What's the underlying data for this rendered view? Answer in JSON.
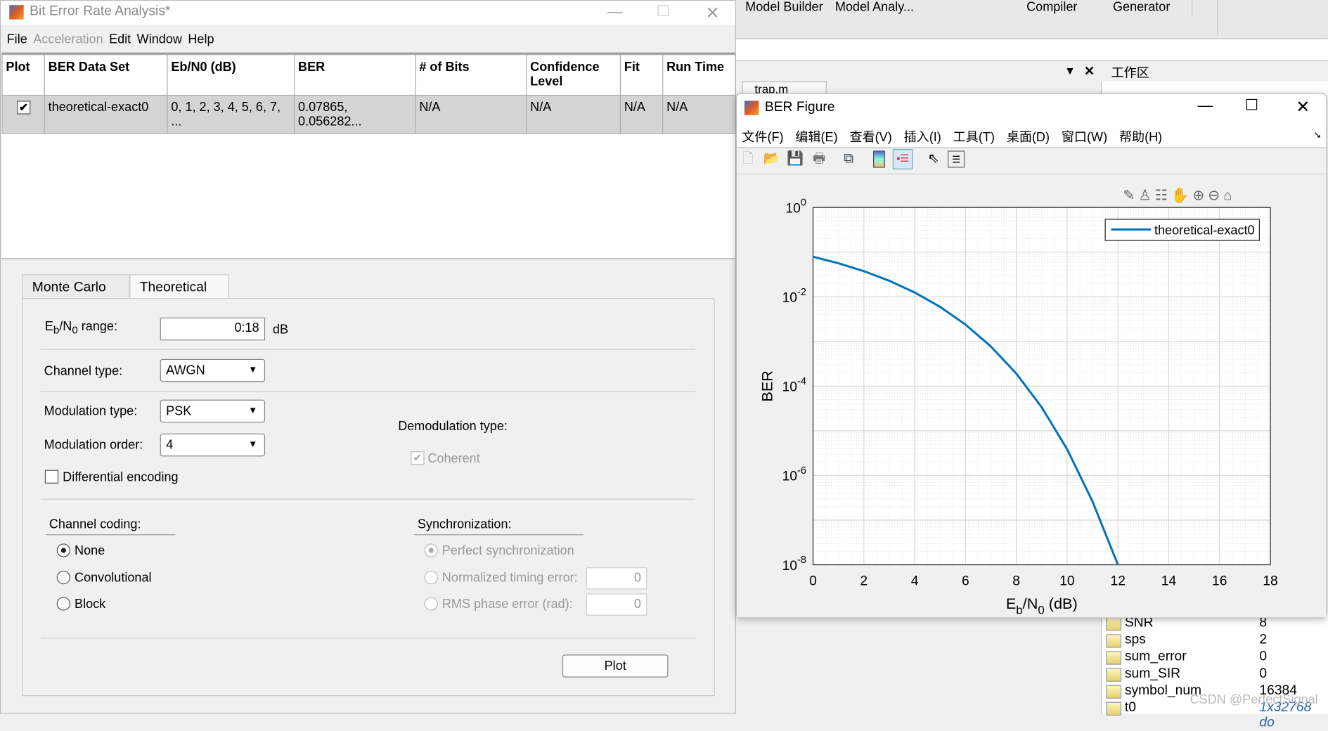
{
  "background": {
    "ribbon": [
      "Model Builder",
      "Model Analy...",
      "Compiler",
      "Generator"
    ],
    "editor_tab": "trap.m",
    "workspace_title": "工作区",
    "workspace": [
      {
        "name": "SNR",
        "value": "8"
      },
      {
        "name": "sps",
        "value": "2"
      },
      {
        "name": "sum_error",
        "value": "0"
      },
      {
        "name": "sum_SIR",
        "value": "0"
      },
      {
        "name": "symbol_num",
        "value": "16384"
      },
      {
        "name": "t0",
        "value": "1x32768 do"
      }
    ],
    "watermark": "CSDN @PerfectSignal"
  },
  "ber_window": {
    "title": "Bit Error Rate Analysis*",
    "menu": [
      {
        "label": "File",
        "enabled": true
      },
      {
        "label": "Acceleration",
        "enabled": false
      },
      {
        "label": "Edit",
        "enabled": true
      },
      {
        "label": "Window",
        "enabled": true
      },
      {
        "label": "Help",
        "enabled": true
      }
    ],
    "table": {
      "headers": [
        "Plot",
        "BER Data Set",
        "Eb/N0 (dB)",
        "BER",
        "# of Bits",
        "Confidence Level",
        "Fit",
        "Run Time"
      ],
      "rows": [
        {
          "plot": true,
          "cells": [
            "theoretical-exact0",
            "0, 1, 2, 3, 4, 5, 6, 7, ...",
            "0.07865, 0.056282...",
            "N/A",
            "N/A",
            "N/A",
            "N/A"
          ]
        }
      ]
    },
    "tabs": [
      {
        "label": "Monte Carlo",
        "active": false
      },
      {
        "label": "Theoretical",
        "active": true
      }
    ],
    "form": {
      "ebno_label_main": "E",
      "ebno_label_sub1": "b",
      "ebno_label_mid": "/N",
      "ebno_label_sub2": "0",
      "ebno_label_end": " range:",
      "ebno_value": "0:18",
      "ebno_unit": "dB",
      "channel_type_label": "Channel type:",
      "channel_type": "AWGN",
      "modulation_type_label": "Modulation type:",
      "modulation_type": "PSK",
      "modulation_order_label": "Modulation order:",
      "modulation_order": "4",
      "demod_label": "Demodulation type:",
      "coherent_label": "Coherent",
      "differential_label": "Differential encoding",
      "channel_coding_label": "Channel coding:",
      "coding_options": [
        "None",
        "Convolutional",
        "Block"
      ],
      "coding_selected": "None",
      "sync_label": "Synchronization:",
      "sync_perfect": "Perfect synchronization",
      "sync_timing": "Normalized timing error:",
      "sync_timing_value": "0",
      "sync_phase": "RMS phase error (rad):",
      "sync_phase_value": "0",
      "plot_button": "Plot"
    }
  },
  "figure_window": {
    "title": "BER Figure",
    "menu": [
      "文件(F)",
      "编辑(E)",
      "查看(V)",
      "插入(I)",
      "工具(T)",
      "桌面(D)",
      "窗口(W)",
      "帮助(H)"
    ],
    "toolbar": [
      "new-file",
      "open-folder",
      "save",
      "print",
      "link",
      "colorbar",
      "legend",
      "pointer",
      "property-inspector"
    ],
    "axes_toolbar": [
      "brush",
      "data-tip",
      "legend-toggle",
      "pan",
      "zoom-in",
      "zoom-out",
      "home"
    ]
  },
  "chart_data": {
    "type": "line",
    "title": "",
    "xlabel": "Eb/N0 (dB)",
    "ylabel": "BER",
    "xlim": [
      0,
      18
    ],
    "ylim": [
      1e-08,
      1
    ],
    "yscale": "log",
    "grid": true,
    "x_ticks": [
      "0",
      "2",
      "4",
      "6",
      "8",
      "10",
      "12",
      "14",
      "16",
      "18"
    ],
    "y_ticks": [
      {
        "base": "10",
        "exp": "0"
      },
      {
        "base": "10",
        "exp": "-2"
      },
      {
        "base": "10",
        "exp": "-4"
      },
      {
        "base": "10",
        "exp": "-6"
      },
      {
        "base": "10",
        "exp": "-8"
      }
    ],
    "legend_position": "top-right",
    "series": [
      {
        "name": "theoretical-exact0",
        "color": "#0072bd",
        "x": [
          0,
          1,
          2,
          3,
          4,
          5,
          6,
          7,
          8,
          9,
          10,
          11,
          12
        ],
        "y": [
          0.07865,
          0.05628,
          0.03751,
          0.02288,
          0.0125,
          0.005954,
          0.002388,
          0.0007727,
          0.0001909,
          3.363e-05,
          3.872e-06,
          2.613e-07,
          9.006e-09
        ]
      }
    ]
  }
}
